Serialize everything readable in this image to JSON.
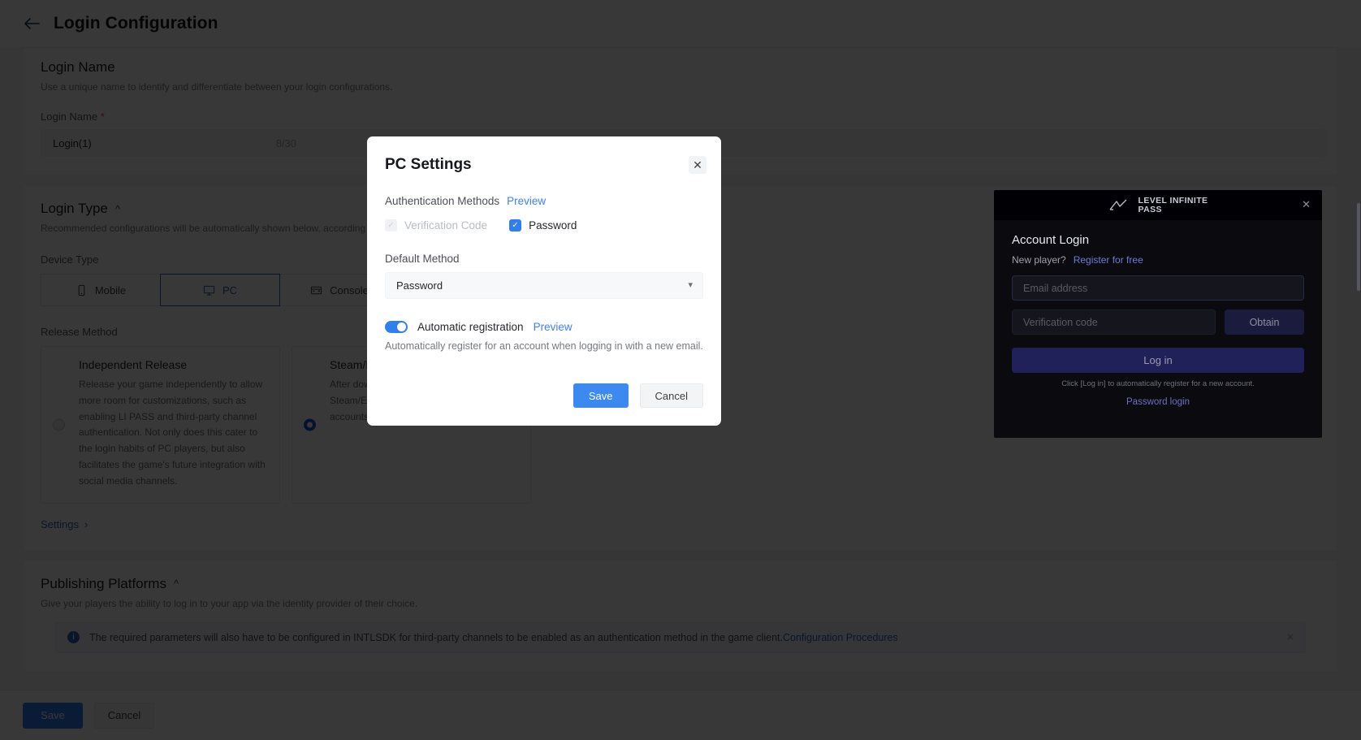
{
  "header": {
    "back_icon": "back-arrow-icon",
    "title": "Login Configuration"
  },
  "login_name_section": {
    "title": "Login Name",
    "description": "Use a unique name to identify and differentiate between your login configurations.",
    "field_label": "Login Name",
    "required_marker": "*",
    "value": "Login(1)",
    "counter": "8/30"
  },
  "login_type_section": {
    "title": "Login Type",
    "collapse_icon": "chevron-up-icon",
    "description": "Recommended configurations will be automatically shown below, according to your choice.",
    "device_type_label": "Device Type",
    "device_tabs": [
      {
        "label": "Mobile",
        "icon": "mobile-icon",
        "active": false
      },
      {
        "label": "PC",
        "icon": "monitor-icon",
        "active": true
      },
      {
        "label": "Console",
        "icon": "console-icon",
        "active": false
      }
    ],
    "release_method_label": "Release Method",
    "release_cards": [
      {
        "title": "Independent Release",
        "description": "Release your game independently to allow more room for customizations, such as enabling LI PASS and third-party channel authentication. Not only does this cater to the login habits of PC players, but also facilitates the game's future integration with social media channels.",
        "selected": false
      },
      {
        "title": "Steam/Epic",
        "description": "After downloading the game through Steam/Epic, players can link their game accounts.",
        "selected": true
      }
    ],
    "settings_link": "Settings",
    "settings_chevron": "chevron-right-icon"
  },
  "publishing_section": {
    "title": "Publishing Platforms",
    "collapse_icon": "chevron-up-icon",
    "description": "Give your players the ability to log in to your app via the identity provider of their choice."
  },
  "info_banner": {
    "icon": "info-icon",
    "text": "The required parameters will also have to be configured in INTLSDK for third-party channels to be enabled as an authentication method in the game client.",
    "link": "Configuration Procedures",
    "close_icon": "close-icon"
  },
  "footer": {
    "save_label": "Save",
    "cancel_label": "Cancel"
  },
  "modal": {
    "title": "PC Settings",
    "close_icon": "close-icon",
    "auth_methods_label": "Authentication Methods",
    "auth_preview_link": "Preview",
    "checkboxes": [
      {
        "label": "Verification Code",
        "checked": false,
        "disabled": true
      },
      {
        "label": "Password",
        "checked": true,
        "disabled": false
      }
    ],
    "default_method_label": "Default Method",
    "default_method_value": "Password",
    "default_method_chevron": "chevron-down-icon",
    "auto_registration_label": "Automatic registration",
    "auto_registration_preview": "Preview",
    "auto_registration_on": true,
    "auto_registration_desc": "Automatically register for an account when logging in with a new email.",
    "save_label": "Save",
    "cancel_label": "Cancel"
  },
  "preview_panel": {
    "logo_line1": "LEVEL INFINITE",
    "logo_line2": "PASS",
    "logo_icon": "level-infinite-logo-icon",
    "close_icon": "close-icon",
    "title": "Account Login",
    "new_player_text": "New player?",
    "register_link": "Register for free",
    "email_placeholder": "Email address",
    "code_placeholder": "Verification code",
    "obtain_label": "Obtain",
    "login_label": "Log in",
    "note": "Click [Log in] to automatically register for a new account.",
    "password_login_link": "Password login"
  },
  "colors": {
    "accent_blue": "#2f7ff0",
    "link_blue": "#2f5fbf",
    "modal_save": "#3c8af0",
    "toggle_on": "#2f7ff0",
    "required_red": "#d4483b"
  }
}
